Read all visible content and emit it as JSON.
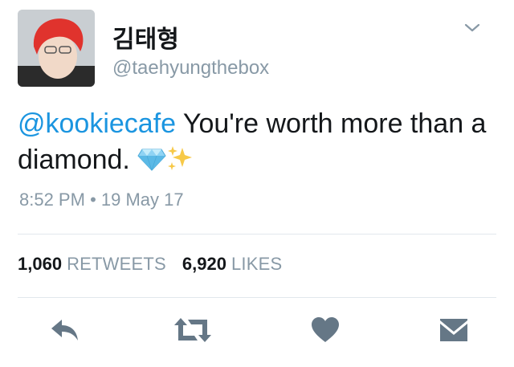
{
  "user": {
    "display_name": "김태형",
    "handle": "@taehyungthebox"
  },
  "tweet": {
    "mention": "@kookiecafe",
    "text": " You're worth more than a diamond.",
    "emojis": [
      "gem-icon",
      "sparkles-icon"
    ],
    "time": "8:52 PM",
    "separator": "•",
    "date": "19 May 17"
  },
  "stats": {
    "retweets_count": "1,060",
    "retweets_label": "RETWEETS",
    "likes_count": "6,920",
    "likes_label": "LIKES"
  },
  "actions": [
    "reply-icon",
    "retweet-icon",
    "like-icon",
    "message-icon"
  ],
  "colors": {
    "link": "#1b95e0",
    "muted": "#8899a6",
    "icon": "#657786",
    "divider": "#e1e8ed"
  }
}
